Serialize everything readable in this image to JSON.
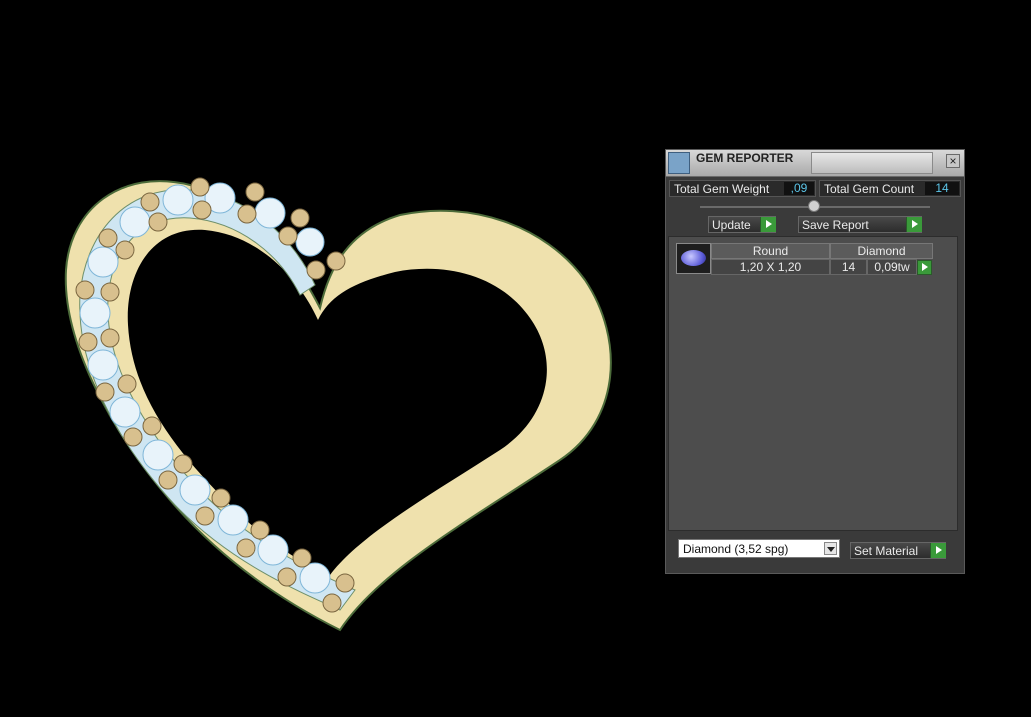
{
  "panel": {
    "title": "GEM REPORTER",
    "total_gem_weight_label": "Total Gem Weight",
    "total_gem_weight_value": ",09",
    "total_gem_count_label": "Total Gem Count",
    "total_gem_count_value": "14",
    "update_label": "Update",
    "save_report_label": "Save Report",
    "table": {
      "col_shape": "Round",
      "col_material": "Diamond",
      "rows": [
        {
          "size": "1,20 X 1,20",
          "count": "14",
          "weight": "0,09tw"
        }
      ]
    },
    "material_select_value": "Diamond    (3,52 spg)",
    "set_material_label": "Set Material"
  },
  "colors": {
    "background": "#000000",
    "metal": "#f3e5b5",
    "value_text": "#5cc5e8",
    "accent_green": "#3a9a3a"
  }
}
